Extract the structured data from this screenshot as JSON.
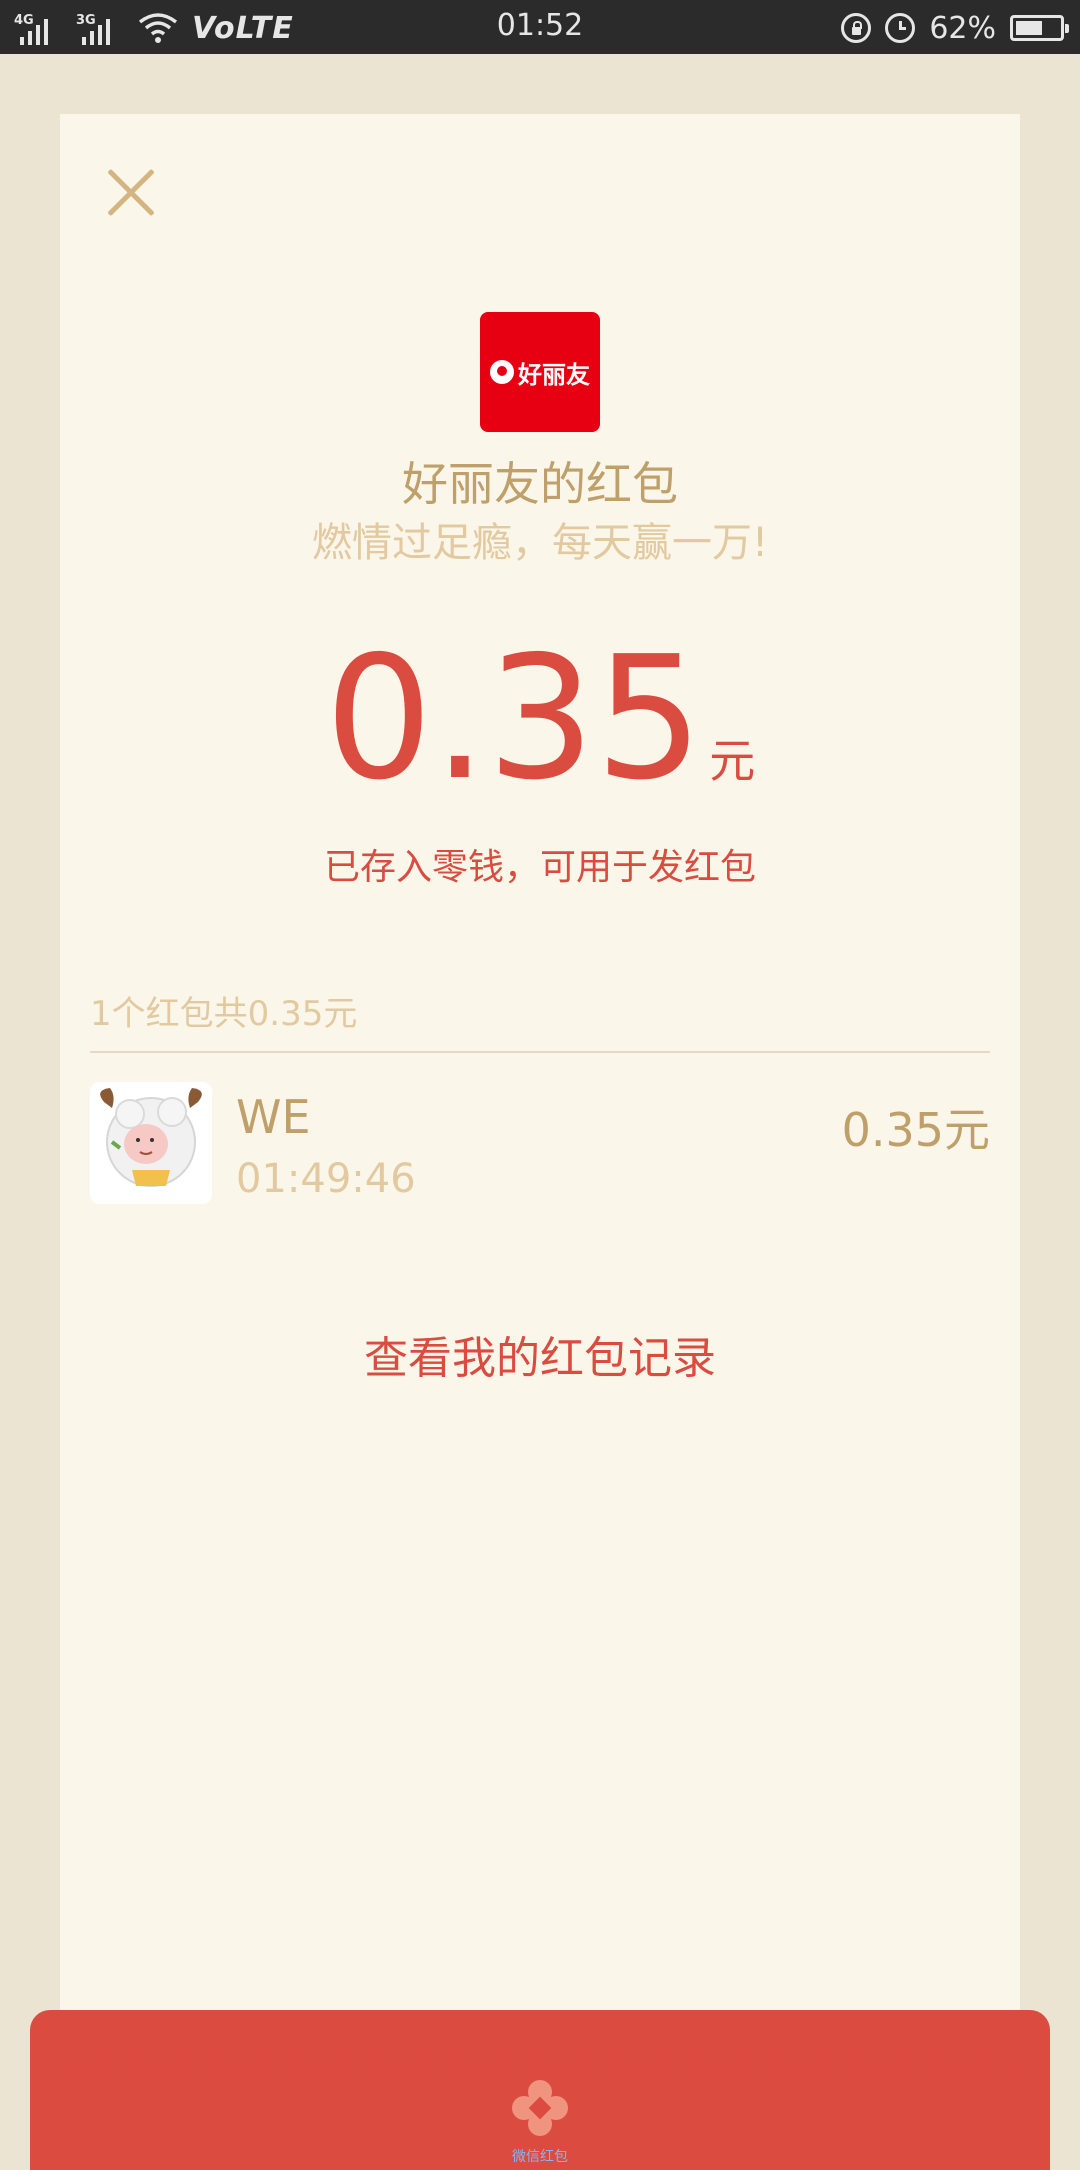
{
  "status_bar": {
    "net1": "4G",
    "net2": "3G",
    "volte": "VoLTE",
    "time": "01:52",
    "battery": "62%",
    "battery_level": 0.62
  },
  "card": {
    "close_icon": "close-icon",
    "logo_text": "好丽友",
    "sender_title": "好丽友的红包",
    "wish": "燃情过足瘾，每天赢一万!",
    "amount": "0.35",
    "unit": "元",
    "stored_note": "已存入零钱，可用于发红包",
    "summary": "1个红包共0.35元",
    "records": [
      {
        "name": "WE",
        "time": "01:49:46",
        "amount": "0.35元"
      }
    ],
    "view_records": "查看我的红包记录"
  },
  "footer": {
    "label": "微信红包"
  },
  "colors": {
    "accent_red": "#da4c40",
    "gold_text": "#bfa06b",
    "light_gold": "#e2c9a0",
    "card_bg": "#fbf6ea",
    "page_bg": "#ece4d3"
  }
}
